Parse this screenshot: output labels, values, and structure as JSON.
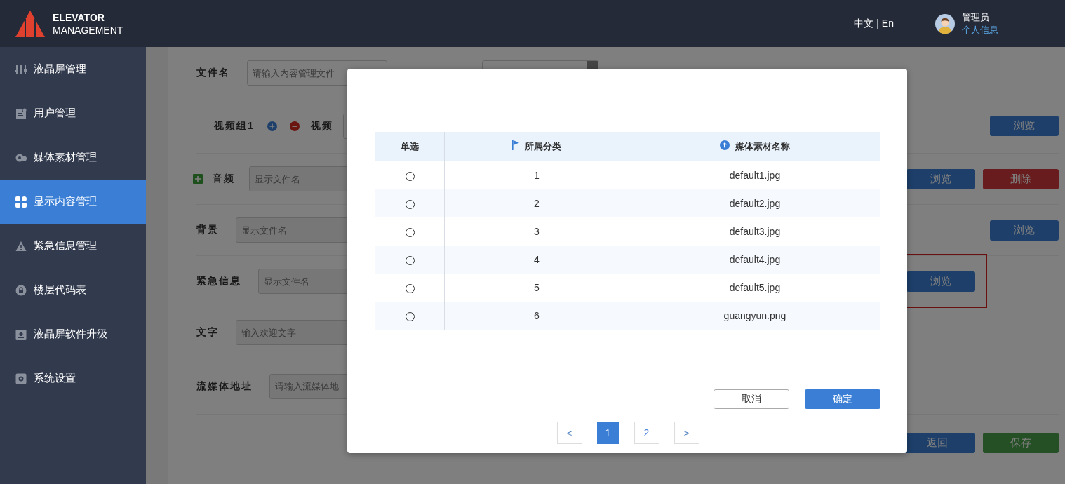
{
  "header": {
    "logo": {
      "line1": "ELEVATOR",
      "line2": "MANAGEMENT"
    },
    "language": "中文 | En",
    "user": {
      "name": "管理员",
      "link": "个人信息"
    }
  },
  "sidebar": {
    "items": [
      {
        "kind": "sliders",
        "label": "液晶屏管理",
        "selected": false
      },
      {
        "kind": "document",
        "label": "用户管理",
        "selected": false
      },
      {
        "kind": "media",
        "label": "媒体素材管理",
        "selected": false
      },
      {
        "kind": "grid",
        "label": "显示内容管理",
        "selected": true
      },
      {
        "kind": "warning",
        "label": "紧急信息管理",
        "selected": false
      },
      {
        "kind": "lock",
        "label": "楼层代码表",
        "selected": false
      },
      {
        "kind": "upload",
        "label": "液晶屏软件升级",
        "selected": false
      },
      {
        "kind": "gear",
        "label": "系统设置",
        "selected": false
      }
    ]
  },
  "form": {
    "rows": [
      {
        "kind": "name",
        "label": "文件名",
        "placeholder": "请输入内容管理文件",
        "select": true
      },
      {
        "kind": "video_group",
        "label": "视频组1",
        "sublabel": "视频",
        "buttons": [
          {
            "label": "浏览",
            "kind": "primary",
            "highlighted": false
          }
        ]
      },
      {
        "kind": "audio",
        "label": "音频",
        "placeholder": "显示文件名",
        "buttons": [
          {
            "label": "浏览",
            "kind": "primary",
            "highlighted": false
          },
          {
            "label": "删除",
            "kind": "danger",
            "highlighted": false
          }
        ]
      },
      {
        "kind": "field",
        "label": "背景",
        "placeholder": "显示文件名",
        "buttons": [
          {
            "label": "浏览",
            "kind": "primary",
            "highlighted": false
          }
        ]
      },
      {
        "kind": "field",
        "label": "紧急信息",
        "placeholder": "显示文件名",
        "buttons": [
          {
            "label": "浏览",
            "kind": "primary",
            "highlighted": true
          }
        ]
      },
      {
        "kind": "field",
        "label": "文字",
        "placeholder": "输入欢迎文字"
      },
      {
        "kind": "field",
        "label": "流媒体地址",
        "placeholder": "请输入流媒体地"
      }
    ],
    "footer_buttons": [
      {
        "label": "返回",
        "kind": "primary"
      },
      {
        "label": "保存",
        "kind": "success"
      }
    ]
  },
  "dialog": {
    "table": {
      "columns": [
        {
          "label": "单选",
          "kind": "plain"
        },
        {
          "label": "所属分类",
          "kind": "flag"
        },
        {
          "label": "媒体素材名称",
          "kind": "sort"
        }
      ],
      "rows": [
        {
          "selected": false,
          "category": "1",
          "name": "default1.jpg"
        },
        {
          "selected": false,
          "category": "2",
          "name": "default2.jpg"
        },
        {
          "selected": false,
          "category": "3",
          "name": "default3.jpg"
        },
        {
          "selected": false,
          "category": "4",
          "name": "default4.jpg"
        },
        {
          "selected": false,
          "category": "5",
          "name": "default5.jpg"
        },
        {
          "selected": false,
          "category": "6",
          "name": "guangyun.png"
        }
      ]
    },
    "buttons": [
      {
        "label": "取消",
        "kind": "plain"
      },
      {
        "label": "确定",
        "kind": "primary"
      }
    ],
    "pagination": [
      {
        "label": "<",
        "kind": "prev",
        "selected": false
      },
      {
        "label": "1",
        "kind": "page",
        "selected": true
      },
      {
        "label": "2",
        "kind": "page",
        "selected": false
      },
      {
        "label": ">",
        "kind": "next",
        "selected": false
      }
    ]
  }
}
